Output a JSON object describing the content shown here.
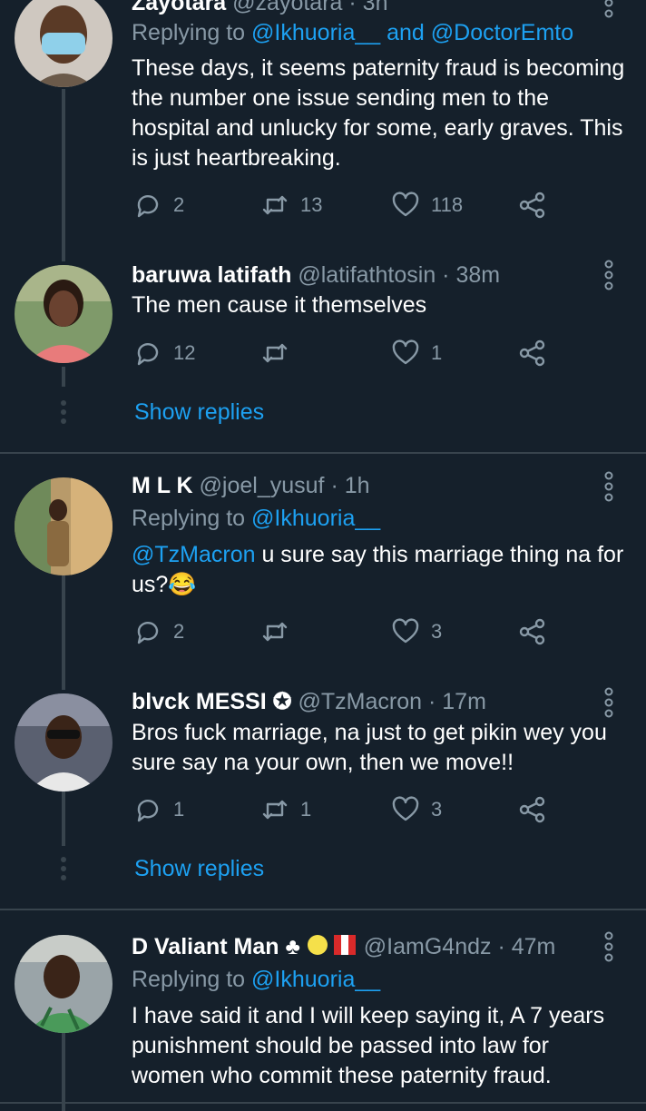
{
  "tweets": [
    {
      "name": "Zayotara",
      "handle": "@zayotara",
      "time": "· 3h",
      "replying_prefix": "Replying to",
      "replying_to": "@Ikhuoria__ and @DoctorEmto",
      "text_lines": [
        "These days, it seems paternity fraud is becoming",
        "the number one issue sending men to the",
        "hospital and unlucky for some, early graves. This",
        "is just heartbreaking."
      ],
      "replies": "2",
      "retweets": "13",
      "likes": "118"
    },
    {
      "name": "baruwa latifath",
      "handle": "@latifathtosin",
      "time": "· 38m",
      "text_lines": [
        "The men cause it themselves"
      ],
      "replies": "12",
      "retweets": "",
      "likes": "1",
      "show_replies": "Show replies"
    },
    {
      "name": "M L K",
      "handle": "@joel_yusuf",
      "time": "· 1h",
      "replying_prefix": "Replying to",
      "replying_to": "@Ikhuoria__",
      "mention": "@TzMacron",
      "text_line1_rest": " u sure say this marriage thing na for",
      "text_line2": "us?😂",
      "replies": "2",
      "retweets": "",
      "likes": "3"
    },
    {
      "name": "blvck MESSI",
      "name_badge": "✪",
      "handle": "@TzMacron",
      "time": "· 17m",
      "text_lines": [
        "Bros fuck marriage, na just to get pikin wey you",
        "sure say na your own, then we move!!"
      ],
      "replies": "1",
      "retweets": "1",
      "likes": "3",
      "show_replies": "Show replies"
    },
    {
      "name": "D Valiant Man ♣",
      "handle": "@IamG4ndz",
      "time": "· 47m",
      "replying_prefix": "Replying to",
      "replying_to": "@Ikhuoria__",
      "text_lines": [
        "I have said it and I will keep saying it,  A 7 years",
        "punishment should be passed into law for",
        "women who commit these paternity fraud."
      ]
    }
  ],
  "icons": {
    "reply": "reply-icon",
    "retweet": "retweet-icon",
    "like": "heart-icon",
    "share": "share-icon",
    "more": "more-options-icon"
  },
  "colors": {
    "background": "#15202b",
    "link": "#1da1f2",
    "secondary_text": "#8899a6",
    "divider": "#38444d"
  }
}
